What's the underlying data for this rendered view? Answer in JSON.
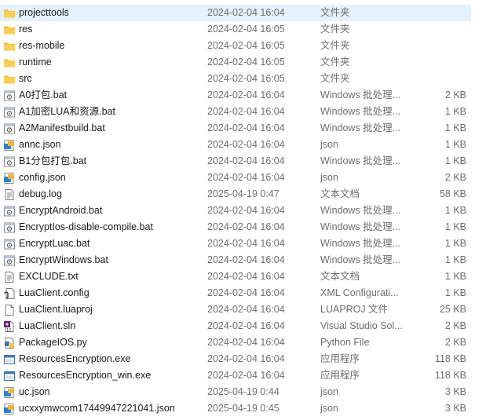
{
  "files": [
    {
      "name": "projecttools",
      "date": "2024-02-04 16:04",
      "type": "文件夹",
      "size": "",
      "icon": "folder-icon"
    },
    {
      "name": "res",
      "date": "2024-02-04 16:05",
      "type": "文件夹",
      "size": "",
      "icon": "folder-icon"
    },
    {
      "name": "res-mobile",
      "date": "2024-02-04 16:05",
      "type": "文件夹",
      "size": "",
      "icon": "folder-icon"
    },
    {
      "name": "runtime",
      "date": "2024-02-04 16:05",
      "type": "文件夹",
      "size": "",
      "icon": "folder-icon"
    },
    {
      "name": "src",
      "date": "2024-02-04 16:05",
      "type": "文件夹",
      "size": "",
      "icon": "folder-icon"
    },
    {
      "name": "A0打包.bat",
      "date": "2024-02-04 16:04",
      "type": "Windows 批处理...",
      "size": "2 KB",
      "icon": "batch-file-icon"
    },
    {
      "name": "A1加密LUA和资源.bat",
      "date": "2024-02-04 16:04",
      "type": "Windows 批处理...",
      "size": "1 KB",
      "icon": "batch-file-icon"
    },
    {
      "name": "A2Manifestbuild.bat",
      "date": "2024-02-04 16:04",
      "type": "Windows 批处理...",
      "size": "1 KB",
      "icon": "batch-file-icon"
    },
    {
      "name": "annc.json",
      "date": "2024-02-04 16:04",
      "type": "json",
      "size": "1 KB",
      "icon": "json-file-icon"
    },
    {
      "name": "B1分包打包.bat",
      "date": "2024-02-04 16:04",
      "type": "Windows 批处理...",
      "size": "1 KB",
      "icon": "batch-file-icon"
    },
    {
      "name": "config.json",
      "date": "2024-02-04 16:04",
      "type": "json",
      "size": "2 KB",
      "icon": "json-file-icon"
    },
    {
      "name": "debug.log",
      "date": "2025-04-19 0:47",
      "type": "文本文档",
      "size": "58 KB",
      "icon": "text-file-icon"
    },
    {
      "name": "EncryptAndroid.bat",
      "date": "2024-02-04 16:04",
      "type": "Windows 批处理...",
      "size": "1 KB",
      "icon": "batch-file-icon"
    },
    {
      "name": "EncryptIos-disable-compile.bat",
      "date": "2024-02-04 16:04",
      "type": "Windows 批处理...",
      "size": "1 KB",
      "icon": "batch-file-icon"
    },
    {
      "name": "EncryptLuac.bat",
      "date": "2024-02-04 16:04",
      "type": "Windows 批处理...",
      "size": "1 KB",
      "icon": "batch-file-icon"
    },
    {
      "name": "EncryptWindows.bat",
      "date": "2024-02-04 16:04",
      "type": "Windows 批处理...",
      "size": "1 KB",
      "icon": "batch-file-icon"
    },
    {
      "name": "EXCLUDE.txt",
      "date": "2024-02-04 16:04",
      "type": "文本文档",
      "size": "1 KB",
      "icon": "text-file-icon"
    },
    {
      "name": "LuaClient.config",
      "date": "2024-02-04 16:04",
      "type": "XML Configurati...",
      "size": "1 KB",
      "icon": "config-file-icon"
    },
    {
      "name": "LuaClient.luaproj",
      "date": "2024-02-04 16:04",
      "type": "LUAPROJ 文件",
      "size": "25 KB",
      "icon": "blank-file-icon"
    },
    {
      "name": "LuaClient.sln",
      "date": "2024-02-04 16:04",
      "type": "Visual Studio Sol...",
      "size": "2 KB",
      "icon": "solution-file-icon"
    },
    {
      "name": "PackageIOS.py",
      "date": "2024-02-04 16:04",
      "type": "Python File",
      "size": "2 KB",
      "icon": "python-file-icon"
    },
    {
      "name": "ResourcesEncryption.exe",
      "date": "2024-02-04 16:04",
      "type": "应用程序",
      "size": "118 KB",
      "icon": "application-icon"
    },
    {
      "name": "ResourcesEncryption_win.exe",
      "date": "2024-02-04 16:04",
      "type": "应用程序",
      "size": "118 KB",
      "icon": "application-icon"
    },
    {
      "name": "uc.json",
      "date": "2025-04-19 0:44",
      "type": "json",
      "size": "3 KB",
      "icon": "json-file-icon"
    },
    {
      "name": "ucxxymwcom17449947221041.json",
      "date": "2025-04-19 0:45",
      "type": "json",
      "size": "3 KB",
      "icon": "json-file-icon"
    }
  ],
  "colors": {
    "folder": "#f5c542",
    "selection": "#e5f1fb",
    "secondary_text": "#6d6d6d"
  }
}
